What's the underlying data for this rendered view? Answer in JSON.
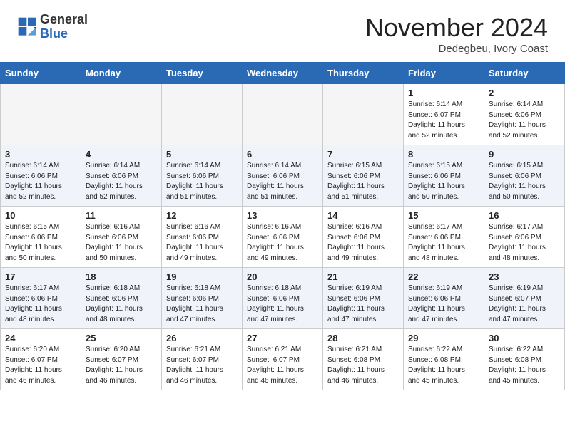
{
  "header": {
    "logo_general": "General",
    "logo_blue": "Blue",
    "month_title": "November 2024",
    "location": "Dedegbeu, Ivory Coast"
  },
  "weekdays": [
    "Sunday",
    "Monday",
    "Tuesday",
    "Wednesday",
    "Thursday",
    "Friday",
    "Saturday"
  ],
  "weeks": [
    {
      "days": [
        {
          "num": "",
          "info": "",
          "empty": true
        },
        {
          "num": "",
          "info": "",
          "empty": true
        },
        {
          "num": "",
          "info": "",
          "empty": true
        },
        {
          "num": "",
          "info": "",
          "empty": true
        },
        {
          "num": "",
          "info": "",
          "empty": true
        },
        {
          "num": "1",
          "info": "Sunrise: 6:14 AM\nSunset: 6:07 PM\nDaylight: 11 hours\nand 52 minutes.",
          "empty": false
        },
        {
          "num": "2",
          "info": "Sunrise: 6:14 AM\nSunset: 6:06 PM\nDaylight: 11 hours\nand 52 minutes.",
          "empty": false
        }
      ]
    },
    {
      "days": [
        {
          "num": "3",
          "info": "Sunrise: 6:14 AM\nSunset: 6:06 PM\nDaylight: 11 hours\nand 52 minutes.",
          "empty": false
        },
        {
          "num": "4",
          "info": "Sunrise: 6:14 AM\nSunset: 6:06 PM\nDaylight: 11 hours\nand 52 minutes.",
          "empty": false
        },
        {
          "num": "5",
          "info": "Sunrise: 6:14 AM\nSunset: 6:06 PM\nDaylight: 11 hours\nand 51 minutes.",
          "empty": false
        },
        {
          "num": "6",
          "info": "Sunrise: 6:14 AM\nSunset: 6:06 PM\nDaylight: 11 hours\nand 51 minutes.",
          "empty": false
        },
        {
          "num": "7",
          "info": "Sunrise: 6:15 AM\nSunset: 6:06 PM\nDaylight: 11 hours\nand 51 minutes.",
          "empty": false
        },
        {
          "num": "8",
          "info": "Sunrise: 6:15 AM\nSunset: 6:06 PM\nDaylight: 11 hours\nand 50 minutes.",
          "empty": false
        },
        {
          "num": "9",
          "info": "Sunrise: 6:15 AM\nSunset: 6:06 PM\nDaylight: 11 hours\nand 50 minutes.",
          "empty": false
        }
      ]
    },
    {
      "days": [
        {
          "num": "10",
          "info": "Sunrise: 6:15 AM\nSunset: 6:06 PM\nDaylight: 11 hours\nand 50 minutes.",
          "empty": false
        },
        {
          "num": "11",
          "info": "Sunrise: 6:16 AM\nSunset: 6:06 PM\nDaylight: 11 hours\nand 50 minutes.",
          "empty": false
        },
        {
          "num": "12",
          "info": "Sunrise: 6:16 AM\nSunset: 6:06 PM\nDaylight: 11 hours\nand 49 minutes.",
          "empty": false
        },
        {
          "num": "13",
          "info": "Sunrise: 6:16 AM\nSunset: 6:06 PM\nDaylight: 11 hours\nand 49 minutes.",
          "empty": false
        },
        {
          "num": "14",
          "info": "Sunrise: 6:16 AM\nSunset: 6:06 PM\nDaylight: 11 hours\nand 49 minutes.",
          "empty": false
        },
        {
          "num": "15",
          "info": "Sunrise: 6:17 AM\nSunset: 6:06 PM\nDaylight: 11 hours\nand 48 minutes.",
          "empty": false
        },
        {
          "num": "16",
          "info": "Sunrise: 6:17 AM\nSunset: 6:06 PM\nDaylight: 11 hours\nand 48 minutes.",
          "empty": false
        }
      ]
    },
    {
      "days": [
        {
          "num": "17",
          "info": "Sunrise: 6:17 AM\nSunset: 6:06 PM\nDaylight: 11 hours\nand 48 minutes.",
          "empty": false
        },
        {
          "num": "18",
          "info": "Sunrise: 6:18 AM\nSunset: 6:06 PM\nDaylight: 11 hours\nand 48 minutes.",
          "empty": false
        },
        {
          "num": "19",
          "info": "Sunrise: 6:18 AM\nSunset: 6:06 PM\nDaylight: 11 hours\nand 47 minutes.",
          "empty": false
        },
        {
          "num": "20",
          "info": "Sunrise: 6:18 AM\nSunset: 6:06 PM\nDaylight: 11 hours\nand 47 minutes.",
          "empty": false
        },
        {
          "num": "21",
          "info": "Sunrise: 6:19 AM\nSunset: 6:06 PM\nDaylight: 11 hours\nand 47 minutes.",
          "empty": false
        },
        {
          "num": "22",
          "info": "Sunrise: 6:19 AM\nSunset: 6:06 PM\nDaylight: 11 hours\nand 47 minutes.",
          "empty": false
        },
        {
          "num": "23",
          "info": "Sunrise: 6:19 AM\nSunset: 6:07 PM\nDaylight: 11 hours\nand 47 minutes.",
          "empty": false
        }
      ]
    },
    {
      "days": [
        {
          "num": "24",
          "info": "Sunrise: 6:20 AM\nSunset: 6:07 PM\nDaylight: 11 hours\nand 46 minutes.",
          "empty": false
        },
        {
          "num": "25",
          "info": "Sunrise: 6:20 AM\nSunset: 6:07 PM\nDaylight: 11 hours\nand 46 minutes.",
          "empty": false
        },
        {
          "num": "26",
          "info": "Sunrise: 6:21 AM\nSunset: 6:07 PM\nDaylight: 11 hours\nand 46 minutes.",
          "empty": false
        },
        {
          "num": "27",
          "info": "Sunrise: 6:21 AM\nSunset: 6:07 PM\nDaylight: 11 hours\nand 46 minutes.",
          "empty": false
        },
        {
          "num": "28",
          "info": "Sunrise: 6:21 AM\nSunset: 6:08 PM\nDaylight: 11 hours\nand 46 minutes.",
          "empty": false
        },
        {
          "num": "29",
          "info": "Sunrise: 6:22 AM\nSunset: 6:08 PM\nDaylight: 11 hours\nand 45 minutes.",
          "empty": false
        },
        {
          "num": "30",
          "info": "Sunrise: 6:22 AM\nSunset: 6:08 PM\nDaylight: 11 hours\nand 45 minutes.",
          "empty": false
        }
      ]
    }
  ]
}
